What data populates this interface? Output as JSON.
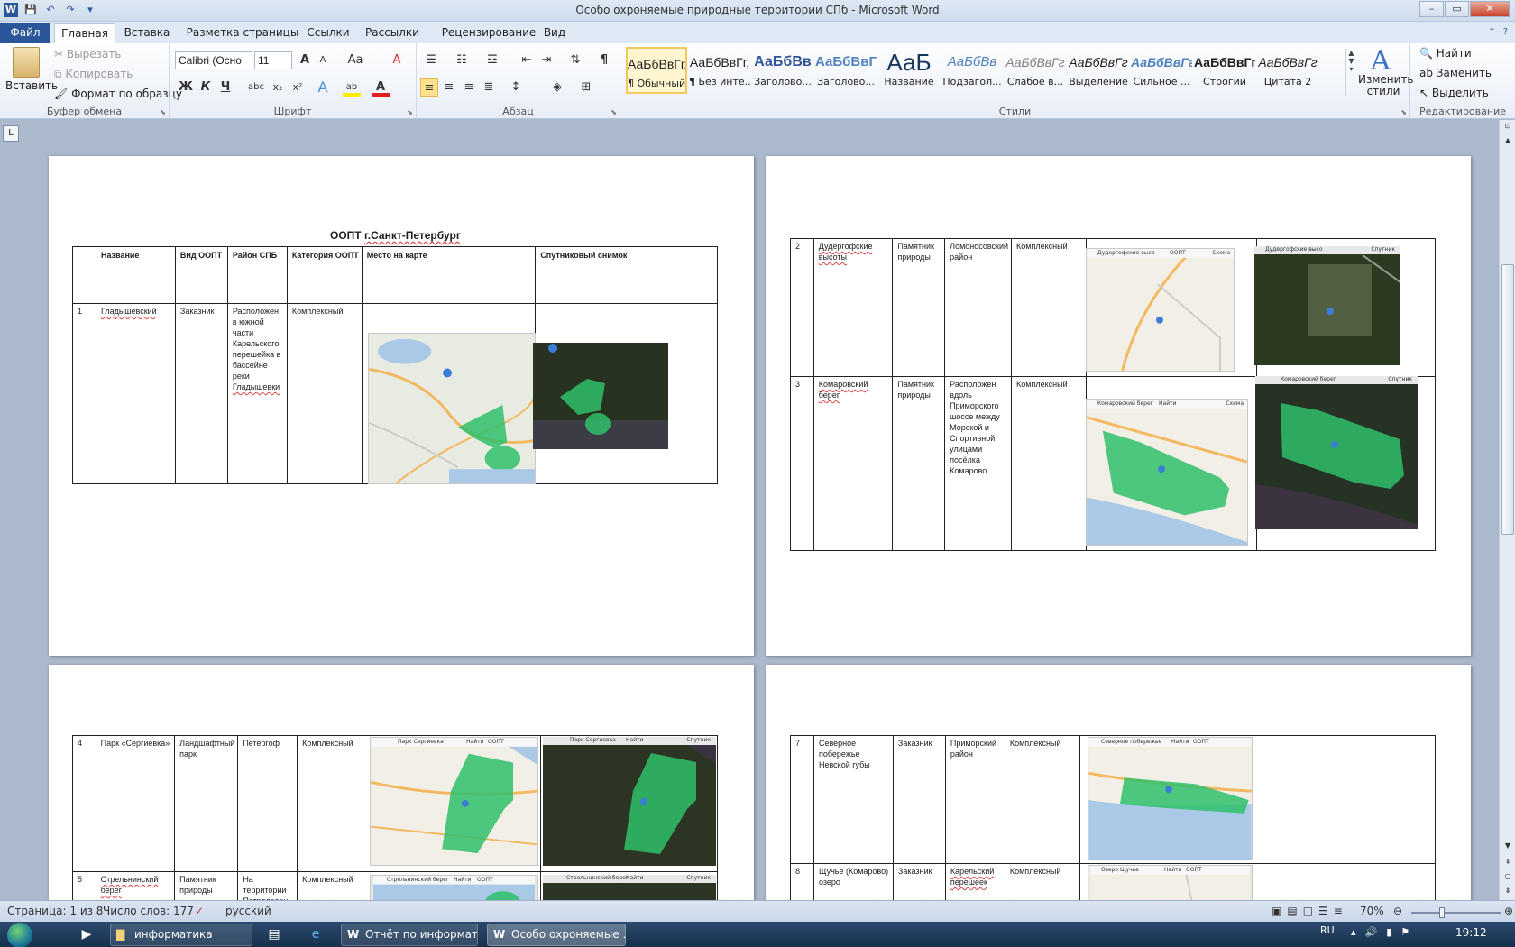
{
  "window": {
    "title": "Особо охроняемые природные территории СПб  -  Microsoft Word",
    "controls": {
      "minimize": "–",
      "maximize": "▭",
      "close": "✕"
    }
  },
  "quick_access": {
    "app_icon": "W",
    "save": "💾",
    "undo": "↶",
    "redo": "↷",
    "customize": "▾"
  },
  "tabs": [
    {
      "label": "Файл"
    },
    {
      "label": "Главная"
    },
    {
      "label": "Вставка"
    },
    {
      "label": "Разметка страницы"
    },
    {
      "label": "Ссылки"
    },
    {
      "label": "Рассылки"
    },
    {
      "label": "Рецензирование"
    },
    {
      "label": "Вид"
    }
  ],
  "ribbon": {
    "clipboard": {
      "label": "Буфер обмена",
      "paste": "Вставить",
      "cut": "Вырезать",
      "copy": "Копировать",
      "format_painter": "Формат по образцу"
    },
    "font": {
      "label": "Шрифт",
      "font_name": "Calibri (Осно",
      "font_size": "11",
      "grow": "A",
      "shrink": "A",
      "case": "Aa",
      "clear": "A",
      "bold": "Ж",
      "italic": "К",
      "underline": "Ч",
      "strike": "abc",
      "subscript": "x₂",
      "superscript": "x²",
      "effects": "A",
      "highlight": "ab",
      "color": "A"
    },
    "paragraph": {
      "label": "Абзац"
    },
    "styles": {
      "label": "Стили",
      "items": [
        {
          "preview": "АаБбВвГг,",
          "name": "¶ Обычный"
        },
        {
          "preview": "АаБбВвГг,",
          "name": "¶ Без инте..."
        },
        {
          "preview": "АаБбВв",
          "name": "Заголово..."
        },
        {
          "preview": "АаБбВвГ",
          "name": "Заголово..."
        },
        {
          "preview": "АаБ",
          "name": "Название"
        },
        {
          "preview": "АаБбВв",
          "name": "Подзагол..."
        },
        {
          "preview": "АаБбВвГг",
          "name": "Слабое в..."
        },
        {
          "preview": "АаБбВвГг",
          "name": "Выделение"
        },
        {
          "preview": "АаБбВвГг",
          "name": "Сильное ..."
        },
        {
          "preview": "АаБбВвГг,",
          "name": "Строгий"
        },
        {
          "preview": "АаБбВвГг",
          "name": "Цитата 2"
        }
      ],
      "change_styles_line1": "Изменить",
      "change_styles_line2": "стили"
    },
    "editing": {
      "label": "Редактирование",
      "find": "Найти",
      "replace": "Заменить",
      "select": "Выделить"
    }
  },
  "document": {
    "title_prefix": "ООПТ ",
    "title_city": "г.Санкт-Петербург",
    "headers": [
      "",
      "Название",
      "Вид ООПТ",
      "Район СПБ",
      "Категория ООПТ",
      "Место на карте",
      "Спутниковый  снимок"
    ],
    "rows": [
      {
        "num": "1",
        "name": "Гладышевский",
        "type": "Заказник",
        "district": "Расположен в южной части Карельского перешейка в бассейне реки",
        "district_tail": "Гладышевки",
        "category": "Комплексный"
      },
      {
        "num": "2",
        "name": "Дудергофские высоты",
        "type": "Памятник природы",
        "district": "Ломоносовский район",
        "category": "Комплексный"
      },
      {
        "num": "3",
        "name": "Комаровский берег",
        "type": "Памятник природы",
        "district": "Расположен вдоль Приморского шоссе между Морской и Спортивной улицами посёлка Комарово",
        "category": "Комплексный"
      },
      {
        "num": "4",
        "name": "Парк «Сергиевка»",
        "type": "Ландшафтный парк",
        "district": "Петергоф",
        "category": "Комплексный"
      },
      {
        "num": "5",
        "name": "Стрельнинский берег",
        "type": "Памятник природы",
        "district": "На территории Петродворц",
        "category": "Комплексный"
      },
      {
        "num": "7",
        "name": "Северное побережье Невской губы",
        "type": "Заказник",
        "district": "Приморский район",
        "category": "Комплексный"
      },
      {
        "num": "8",
        "name": "Щучье (Комарово) озеро",
        "type": "Заказник",
        "district": "Карельский перешеек",
        "category": "Комплексный"
      }
    ],
    "map_labels": {
      "map2": "Дудергофские высо",
      "map3": "Комаровский берег",
      "map4": "Парк Сергиевка",
      "map5": "Стрельнинский берег",
      "map7": "Северное побережье",
      "map8": "Озеро Щучье",
      "find": "Найти",
      "oopt": "ООПТ",
      "scheme": "Схема",
      "satellite": "Спутник"
    }
  },
  "status": {
    "page": "Страница: 1 из 8",
    "words": "Число слов: 177",
    "language": "русский",
    "zoom": "70%",
    "zoom_level": 0.7
  },
  "taskbar": {
    "items": [
      "информатика",
      "Отчёт по информат...",
      "Особо охроняемые ..."
    ],
    "lang": "RU",
    "time": "19:12"
  },
  "colors": {
    "ribbon_accent": "#2b579a",
    "oopt_fill": "#2fbf6a",
    "map_water": "#a9c9e6"
  }
}
